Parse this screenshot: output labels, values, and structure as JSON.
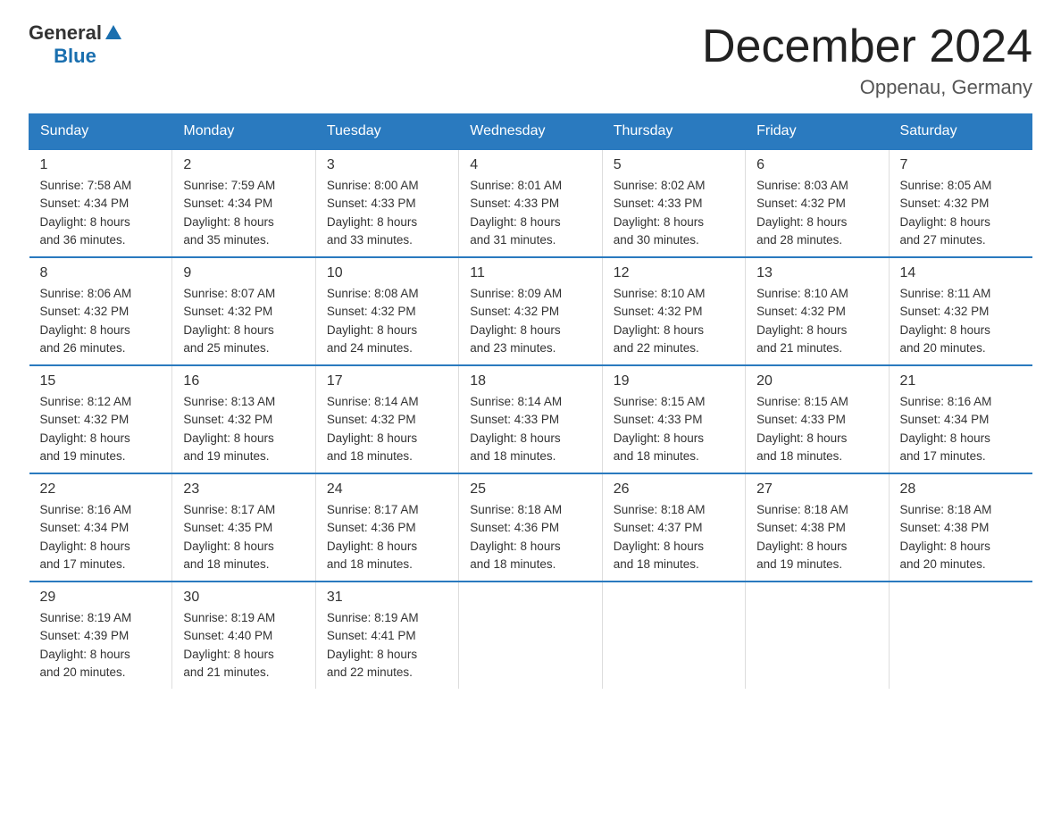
{
  "header": {
    "logo_general": "General",
    "logo_blue": "Blue",
    "month_title": "December 2024",
    "location": "Oppenau, Germany"
  },
  "days_of_week": [
    "Sunday",
    "Monday",
    "Tuesday",
    "Wednesday",
    "Thursday",
    "Friday",
    "Saturday"
  ],
  "weeks": [
    [
      {
        "day": "1",
        "info": "Sunrise: 7:58 AM\nSunset: 4:34 PM\nDaylight: 8 hours\nand 36 minutes."
      },
      {
        "day": "2",
        "info": "Sunrise: 7:59 AM\nSunset: 4:34 PM\nDaylight: 8 hours\nand 35 minutes."
      },
      {
        "day": "3",
        "info": "Sunrise: 8:00 AM\nSunset: 4:33 PM\nDaylight: 8 hours\nand 33 minutes."
      },
      {
        "day": "4",
        "info": "Sunrise: 8:01 AM\nSunset: 4:33 PM\nDaylight: 8 hours\nand 31 minutes."
      },
      {
        "day": "5",
        "info": "Sunrise: 8:02 AM\nSunset: 4:33 PM\nDaylight: 8 hours\nand 30 minutes."
      },
      {
        "day": "6",
        "info": "Sunrise: 8:03 AM\nSunset: 4:32 PM\nDaylight: 8 hours\nand 28 minutes."
      },
      {
        "day": "7",
        "info": "Sunrise: 8:05 AM\nSunset: 4:32 PM\nDaylight: 8 hours\nand 27 minutes."
      }
    ],
    [
      {
        "day": "8",
        "info": "Sunrise: 8:06 AM\nSunset: 4:32 PM\nDaylight: 8 hours\nand 26 minutes."
      },
      {
        "day": "9",
        "info": "Sunrise: 8:07 AM\nSunset: 4:32 PM\nDaylight: 8 hours\nand 25 minutes."
      },
      {
        "day": "10",
        "info": "Sunrise: 8:08 AM\nSunset: 4:32 PM\nDaylight: 8 hours\nand 24 minutes."
      },
      {
        "day": "11",
        "info": "Sunrise: 8:09 AM\nSunset: 4:32 PM\nDaylight: 8 hours\nand 23 minutes."
      },
      {
        "day": "12",
        "info": "Sunrise: 8:10 AM\nSunset: 4:32 PM\nDaylight: 8 hours\nand 22 minutes."
      },
      {
        "day": "13",
        "info": "Sunrise: 8:10 AM\nSunset: 4:32 PM\nDaylight: 8 hours\nand 21 minutes."
      },
      {
        "day": "14",
        "info": "Sunrise: 8:11 AM\nSunset: 4:32 PM\nDaylight: 8 hours\nand 20 minutes."
      }
    ],
    [
      {
        "day": "15",
        "info": "Sunrise: 8:12 AM\nSunset: 4:32 PM\nDaylight: 8 hours\nand 19 minutes."
      },
      {
        "day": "16",
        "info": "Sunrise: 8:13 AM\nSunset: 4:32 PM\nDaylight: 8 hours\nand 19 minutes."
      },
      {
        "day": "17",
        "info": "Sunrise: 8:14 AM\nSunset: 4:32 PM\nDaylight: 8 hours\nand 18 minutes."
      },
      {
        "day": "18",
        "info": "Sunrise: 8:14 AM\nSunset: 4:33 PM\nDaylight: 8 hours\nand 18 minutes."
      },
      {
        "day": "19",
        "info": "Sunrise: 8:15 AM\nSunset: 4:33 PM\nDaylight: 8 hours\nand 18 minutes."
      },
      {
        "day": "20",
        "info": "Sunrise: 8:15 AM\nSunset: 4:33 PM\nDaylight: 8 hours\nand 18 minutes."
      },
      {
        "day": "21",
        "info": "Sunrise: 8:16 AM\nSunset: 4:34 PM\nDaylight: 8 hours\nand 17 minutes."
      }
    ],
    [
      {
        "day": "22",
        "info": "Sunrise: 8:16 AM\nSunset: 4:34 PM\nDaylight: 8 hours\nand 17 minutes."
      },
      {
        "day": "23",
        "info": "Sunrise: 8:17 AM\nSunset: 4:35 PM\nDaylight: 8 hours\nand 18 minutes."
      },
      {
        "day": "24",
        "info": "Sunrise: 8:17 AM\nSunset: 4:36 PM\nDaylight: 8 hours\nand 18 minutes."
      },
      {
        "day": "25",
        "info": "Sunrise: 8:18 AM\nSunset: 4:36 PM\nDaylight: 8 hours\nand 18 minutes."
      },
      {
        "day": "26",
        "info": "Sunrise: 8:18 AM\nSunset: 4:37 PM\nDaylight: 8 hours\nand 18 minutes."
      },
      {
        "day": "27",
        "info": "Sunrise: 8:18 AM\nSunset: 4:38 PM\nDaylight: 8 hours\nand 19 minutes."
      },
      {
        "day": "28",
        "info": "Sunrise: 8:18 AM\nSunset: 4:38 PM\nDaylight: 8 hours\nand 20 minutes."
      }
    ],
    [
      {
        "day": "29",
        "info": "Sunrise: 8:19 AM\nSunset: 4:39 PM\nDaylight: 8 hours\nand 20 minutes."
      },
      {
        "day": "30",
        "info": "Sunrise: 8:19 AM\nSunset: 4:40 PM\nDaylight: 8 hours\nand 21 minutes."
      },
      {
        "day": "31",
        "info": "Sunrise: 8:19 AM\nSunset: 4:41 PM\nDaylight: 8 hours\nand 22 minutes."
      },
      {
        "day": "",
        "info": ""
      },
      {
        "day": "",
        "info": ""
      },
      {
        "day": "",
        "info": ""
      },
      {
        "day": "",
        "info": ""
      }
    ]
  ]
}
